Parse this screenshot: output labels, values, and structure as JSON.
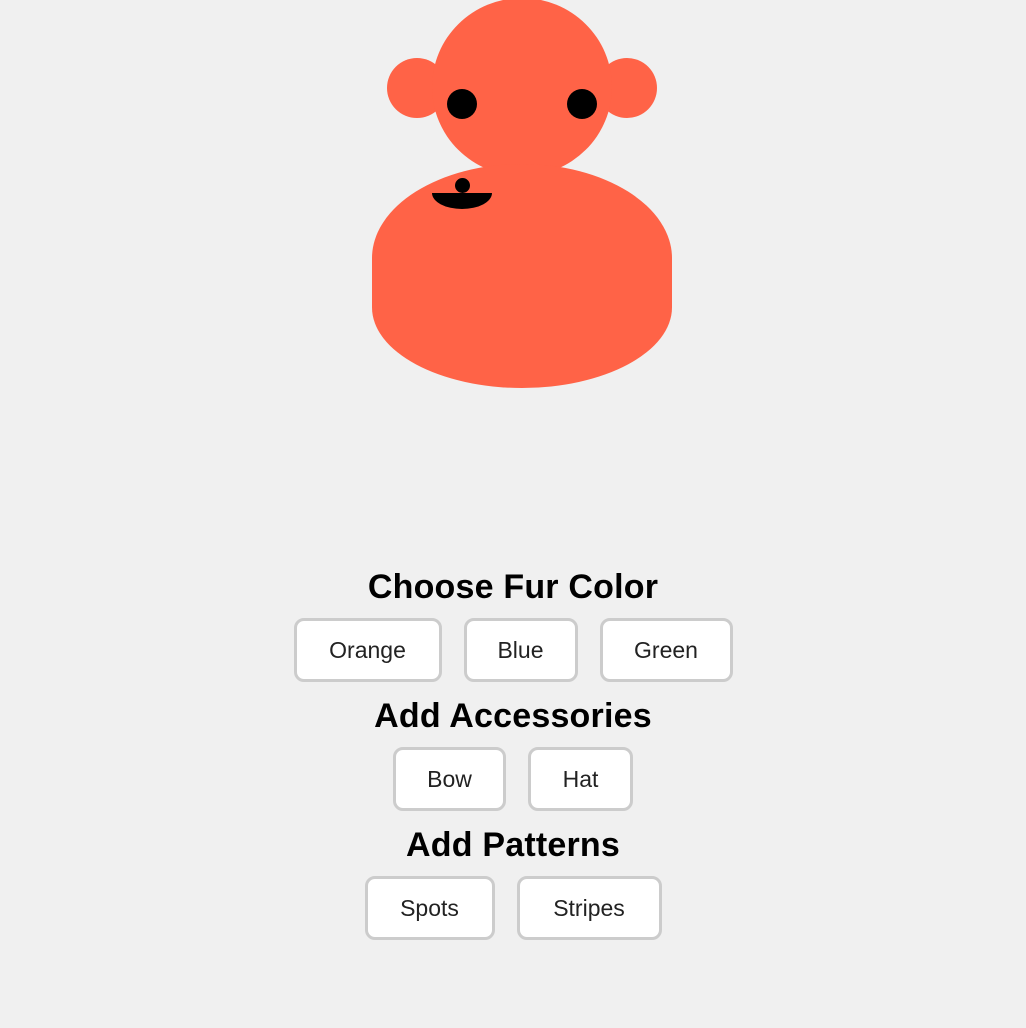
{
  "character": {
    "fur_color": "#ff6347",
    "feature_color": "#000000",
    "parts": [
      "head",
      "left-ear",
      "right-ear",
      "left-eye",
      "right-eye",
      "nose",
      "mouth",
      "body"
    ]
  },
  "sections": {
    "fur": {
      "title": "Choose Fur Color",
      "buttons": [
        "Orange",
        "Blue",
        "Green"
      ]
    },
    "accessories": {
      "title": "Add Accessories",
      "buttons": [
        "Bow",
        "Hat"
      ]
    },
    "patterns": {
      "title": "Add Patterns",
      "buttons": [
        "Spots",
        "Stripes"
      ]
    }
  },
  "colors": {
    "background": "#f0f0f0",
    "button_background": "#ffffff",
    "button_border": "#cccccc"
  }
}
